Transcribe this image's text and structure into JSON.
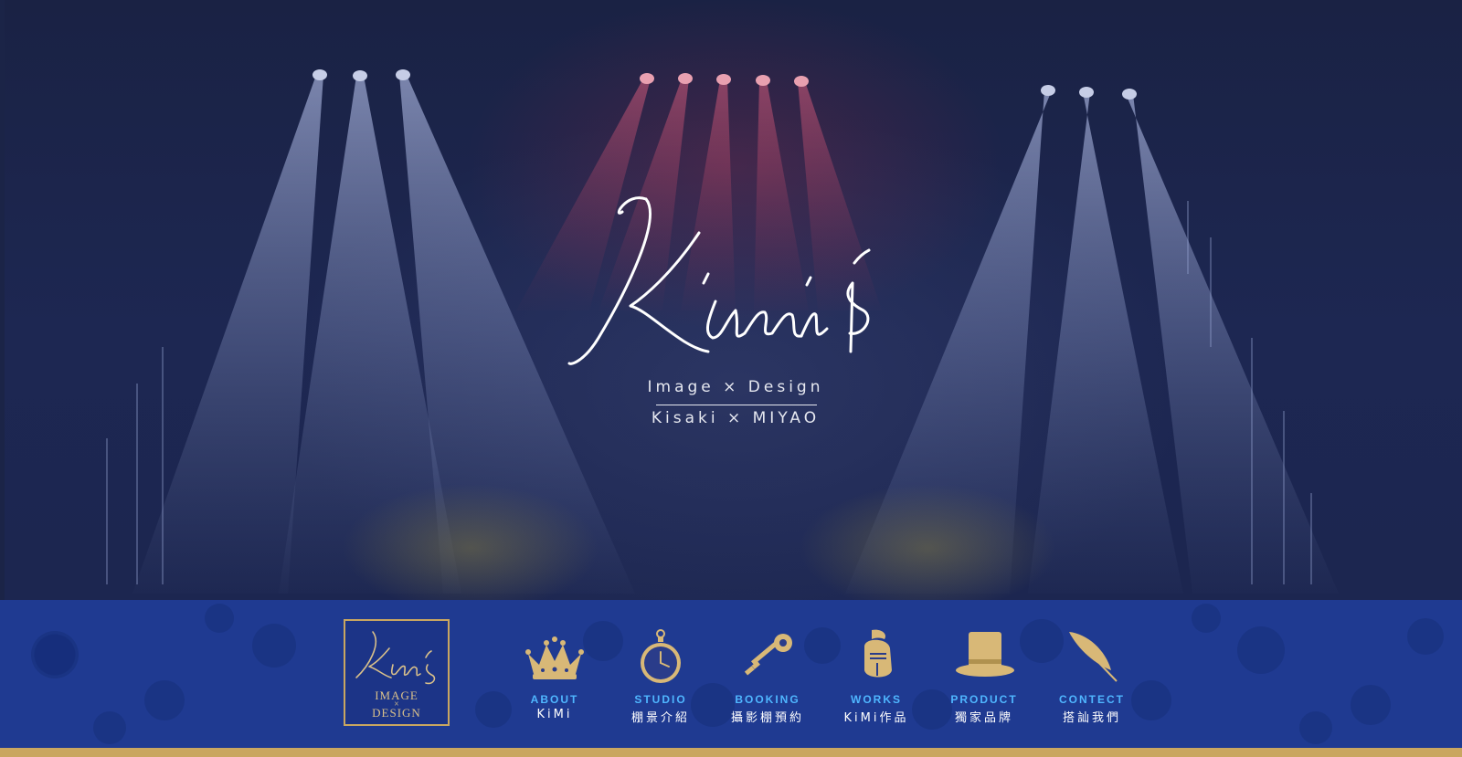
{
  "hero": {
    "logo_text": "Kimi's",
    "tagline_line1": "Image × Design",
    "tagline_line2": "Kisaki × MIYAO"
  },
  "brand": {
    "logo_text": "Kimi's",
    "sub_image": "IMAGE",
    "sub_x": "×",
    "sub_design": "DESIGN"
  },
  "nav": {
    "items": [
      {
        "en": "ABOUT",
        "zh": "KiMi",
        "icon": "crown-icon"
      },
      {
        "en": "STUDIO",
        "zh": "棚景介紹",
        "icon": "pocket-watch-icon"
      },
      {
        "en": "BOOKING",
        "zh": "攝影棚預約",
        "icon": "key-icon"
      },
      {
        "en": "WORKS",
        "zh": "KiMi作品",
        "icon": "knight-helmet-icon"
      },
      {
        "en": "PRODUCT",
        "zh": "獨家品牌",
        "icon": "top-hat-icon"
      },
      {
        "en": "CONTECT",
        "zh": "搭訕我們",
        "icon": "quill-feather-icon"
      }
    ]
  },
  "colors": {
    "hero_bg": "#1c2650",
    "nav_bg": "#1f3a91",
    "gold": "#c9a660",
    "nav_en": "#4fb6ff",
    "nav_zh": "#ffffff"
  }
}
